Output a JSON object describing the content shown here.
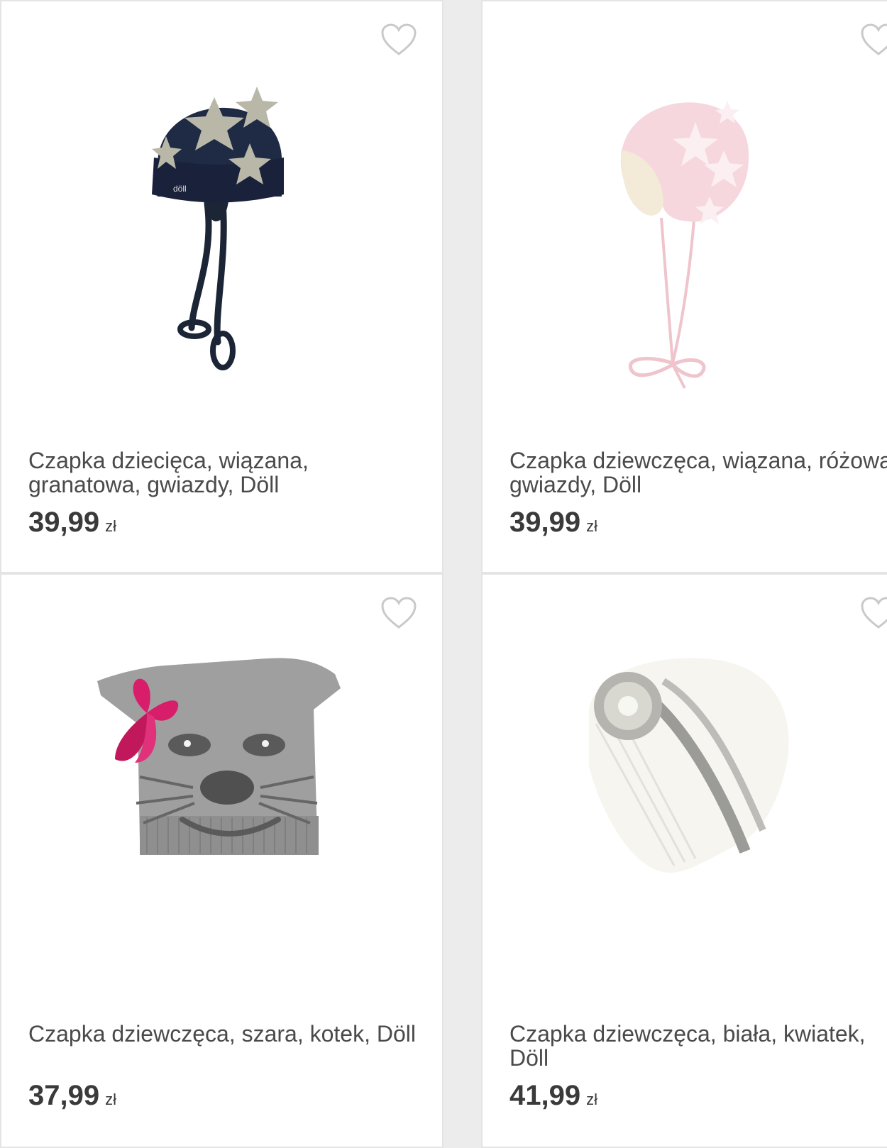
{
  "colors": {
    "background": "#ececec",
    "card": "#ffffff",
    "border": "#e4e4e4",
    "text": "#4a4a4a",
    "heart": "#c9c9c9"
  },
  "products": [
    {
      "title": "Czapka dziecięca, wiązana, granatowa, gwiazdy, Döll",
      "price": "39,99",
      "currency": "zł",
      "favorite_icon": "heart-outline-icon"
    },
    {
      "title": "Czapka dziewczęca, wiązana, różowa, gwiazdy, Döll",
      "price": "39,99",
      "currency": "zł",
      "favorite_icon": "heart-outline-icon"
    },
    {
      "title": "Czapka dziewczęca, szara, kotek, Döll",
      "price": "37,99",
      "currency": "zł",
      "favorite_icon": "heart-outline-icon"
    },
    {
      "title": "Czapka dziewczęca, biała, kwiatek, Döll",
      "price": "41,99",
      "currency": "zł",
      "favorite_icon": "heart-outline-icon"
    }
  ]
}
